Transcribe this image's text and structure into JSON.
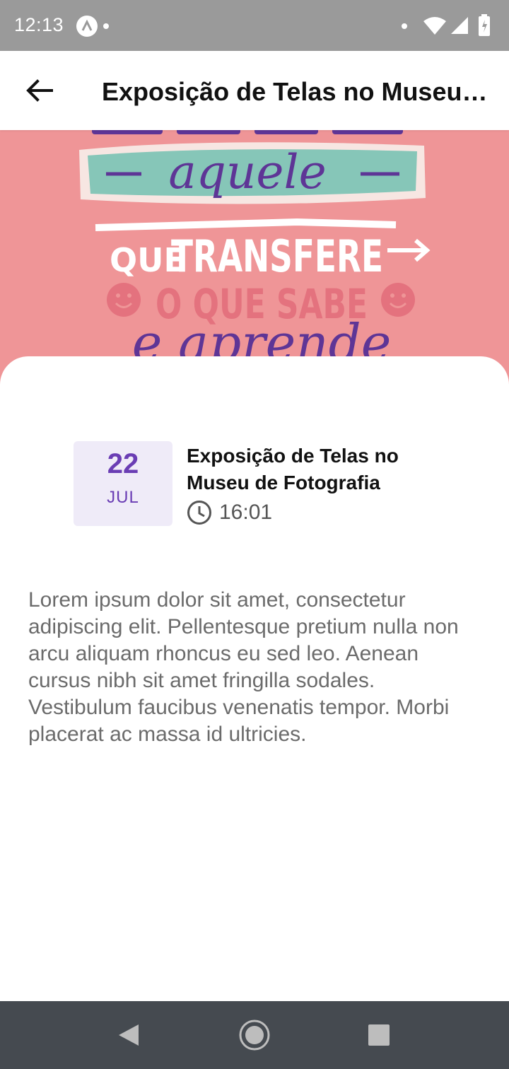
{
  "status_bar": {
    "time": "12:13"
  },
  "app_bar": {
    "title": "Exposição de Telas no Museu de Fotografia",
    "back_icon": "arrow-left-icon"
  },
  "hero": {
    "words": [
      "aquele",
      "QUE",
      "TRANSFERE",
      "O QUE SABE",
      "e aprende"
    ],
    "colors": {
      "background": "#ef9597",
      "teal": "#86c6b8",
      "purple": "#5e3596",
      "pink": "#e4727e"
    }
  },
  "event": {
    "day": "22",
    "month": "JUL",
    "title": "Exposição de Telas no Museu de Fotografia",
    "time": "16:01",
    "time_icon": "clock-icon"
  },
  "description": "Lorem ipsum dolor sit amet, consectetur adipiscing elit. Pellentesque pretium nulla non arcu aliquam rhoncus eu sed leo. Aenean cursus nibh sit amet fringilla sodales. Vestibulum faucibus venenatis tempor. Morbi placerat ac massa id ultricies.",
  "theme": {
    "accent": "#6a3db4",
    "date_box_bg": "#efebf8",
    "nav_bar_bg": "#454a50",
    "status_bar_bg": "#9a9a9a"
  }
}
